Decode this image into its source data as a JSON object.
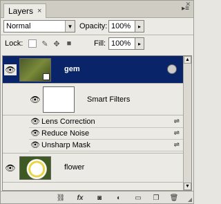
{
  "panel": {
    "tab_label": "Layers",
    "tab_close": "×",
    "menu_glyph": "▸≡",
    "close_glyph": "✕"
  },
  "blend": {
    "mode": "Normal",
    "opacity_label": "Opacity:",
    "opacity_value": "100%",
    "lock_label": "Lock:",
    "fill_label": "Fill:",
    "fill_value": "100%"
  },
  "layers": [
    {
      "name": "gem",
      "selected": true,
      "visible": true,
      "smart_object": true
    },
    {
      "name": "Smart Filters",
      "type": "filter-mask"
    },
    {
      "name": "flower",
      "selected": false,
      "visible": true
    }
  ],
  "smart_filters": {
    "label": "Smart Filters",
    "items": [
      "Lens Correction",
      "Reduce Noise",
      "Unsharp Mask"
    ]
  },
  "icons": {
    "eye": "visibility-eye-icon",
    "link": "link-layers-icon",
    "fx": "layer-style-icon",
    "mask": "add-mask-icon",
    "adjust": "new-adjustment-icon",
    "group": "new-group-icon",
    "new": "new-layer-icon",
    "trash": "delete-layer-icon"
  },
  "colors": {
    "selection": "#0a246a",
    "panel_bg": "#eceae4"
  }
}
